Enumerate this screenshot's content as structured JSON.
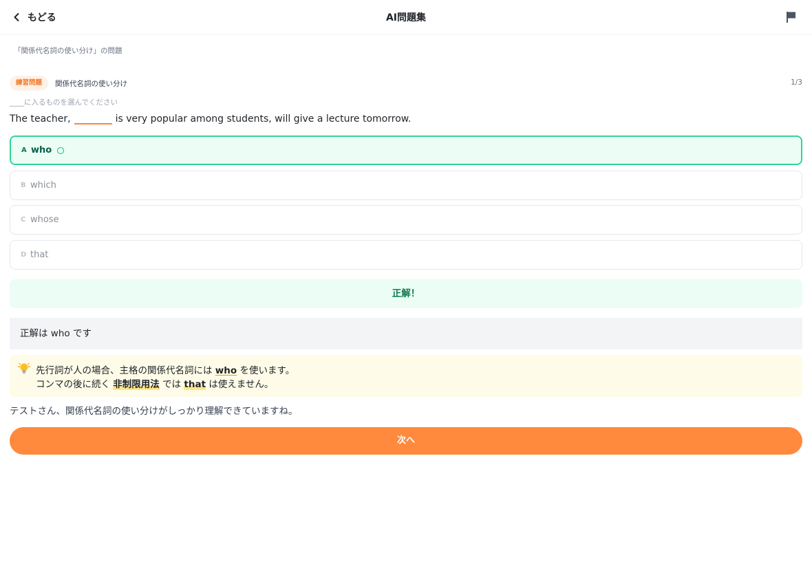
{
  "header": {
    "back_label": "もどる",
    "title": "AI問題集",
    "back_icon": "chevron-left-icon",
    "flag_icon": "flag-icon"
  },
  "breadcrumb": "「関係代名詞の使い分け」の問題",
  "question_meta": {
    "tag": "練習問題",
    "topic": "関係代名詞の使い分け",
    "progress": "1/3"
  },
  "instruction": "____に入るものを選んでください",
  "question": {
    "before": "The teacher,",
    "after": "is very popular among students, will give a lecture tomorrow."
  },
  "options": [
    {
      "letter": "A",
      "text": "who",
      "state": "correct"
    },
    {
      "letter": "B",
      "text": "which",
      "state": "default"
    },
    {
      "letter": "C",
      "text": "whose",
      "state": "default"
    },
    {
      "letter": "D",
      "text": "that",
      "state": "default"
    }
  ],
  "result": "正解！",
  "answer_text": "正解は who です",
  "explanation": {
    "icon": "lightbulb-icon",
    "line1_a": "先行詞が人の場合、主格の関係代名詞には",
    "line1_kw": "who",
    "line1_b": "を使います。",
    "line2_a": "コンマの後に続く",
    "line2_kw1": "非制限用法",
    "line2_b": "では",
    "line2_kw2": "that",
    "line2_c": "は使えません。"
  },
  "feedback": "テストさん、関係代名詞の使い分けがしっかり理解できていますね。",
  "next_label": "次へ",
  "colors": {
    "accent": "#ff8a3d",
    "correct_border": "#34d399",
    "correct_bg": "#ecfdf5",
    "correct_text": "#0f7a4f",
    "hint_bg": "#fefce8"
  }
}
